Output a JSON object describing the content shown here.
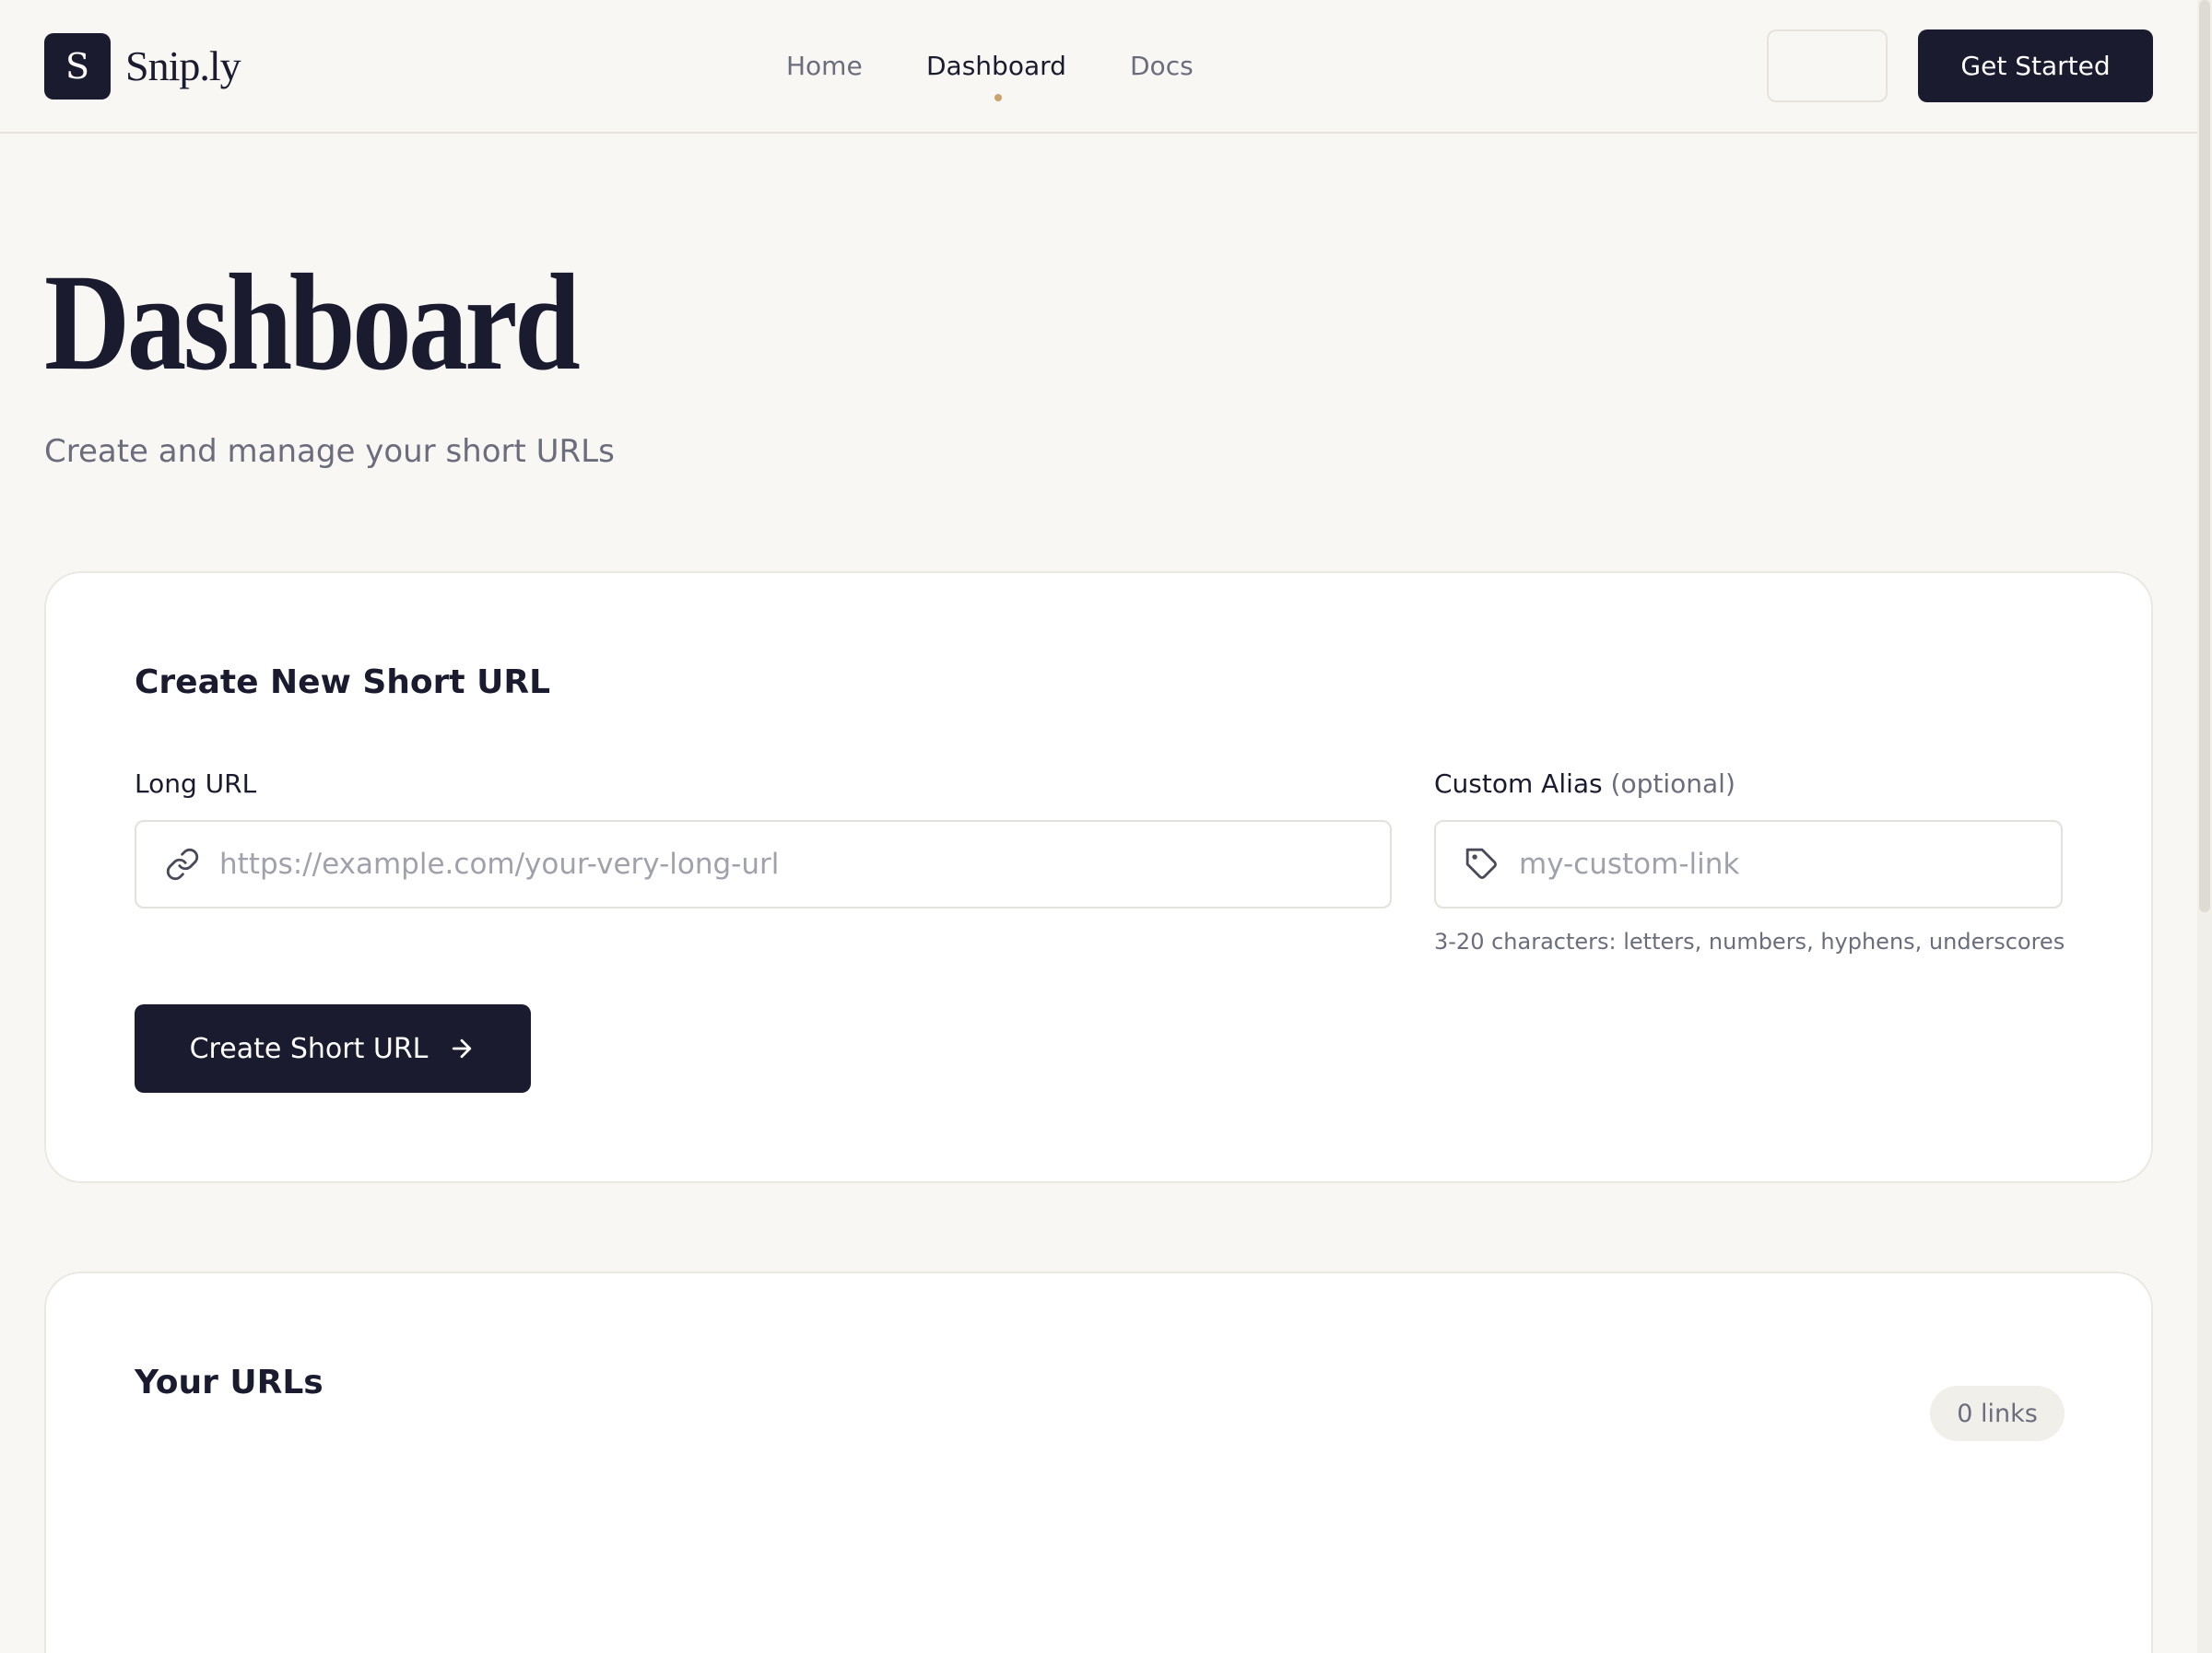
{
  "brand": {
    "logo_letter": "S",
    "name": "Snip.ly"
  },
  "nav": {
    "items": [
      {
        "label": "Home"
      },
      {
        "label": "Dashboard"
      },
      {
        "label": "Docs"
      }
    ],
    "active": "Dashboard",
    "cta_label": "Get Started"
  },
  "page": {
    "title": "Dashboard",
    "subtitle": "Create and manage your short URLs"
  },
  "create_card": {
    "title": "Create New Short URL",
    "long_url": {
      "label": "Long URL",
      "value": "",
      "placeholder": "https://example.com/your-very-long-url",
      "icon": "link-icon"
    },
    "alias": {
      "label": "Custom Alias",
      "optional_text": "(optional)",
      "value": "",
      "placeholder": "my-custom-link",
      "icon": "tag-icon",
      "hint": "3-20 characters: letters, numbers, hyphens, underscores"
    },
    "submit_label": "Create Short URL",
    "submit_icon": "arrow-right-icon"
  },
  "urls_card": {
    "title": "Your URLs",
    "count_label": "0 links"
  },
  "colors": {
    "primary": "#1a1b2e",
    "background": "#f8f7f4",
    "accent_dot": "#c9a36b",
    "muted_text": "#6b6d7d"
  }
}
